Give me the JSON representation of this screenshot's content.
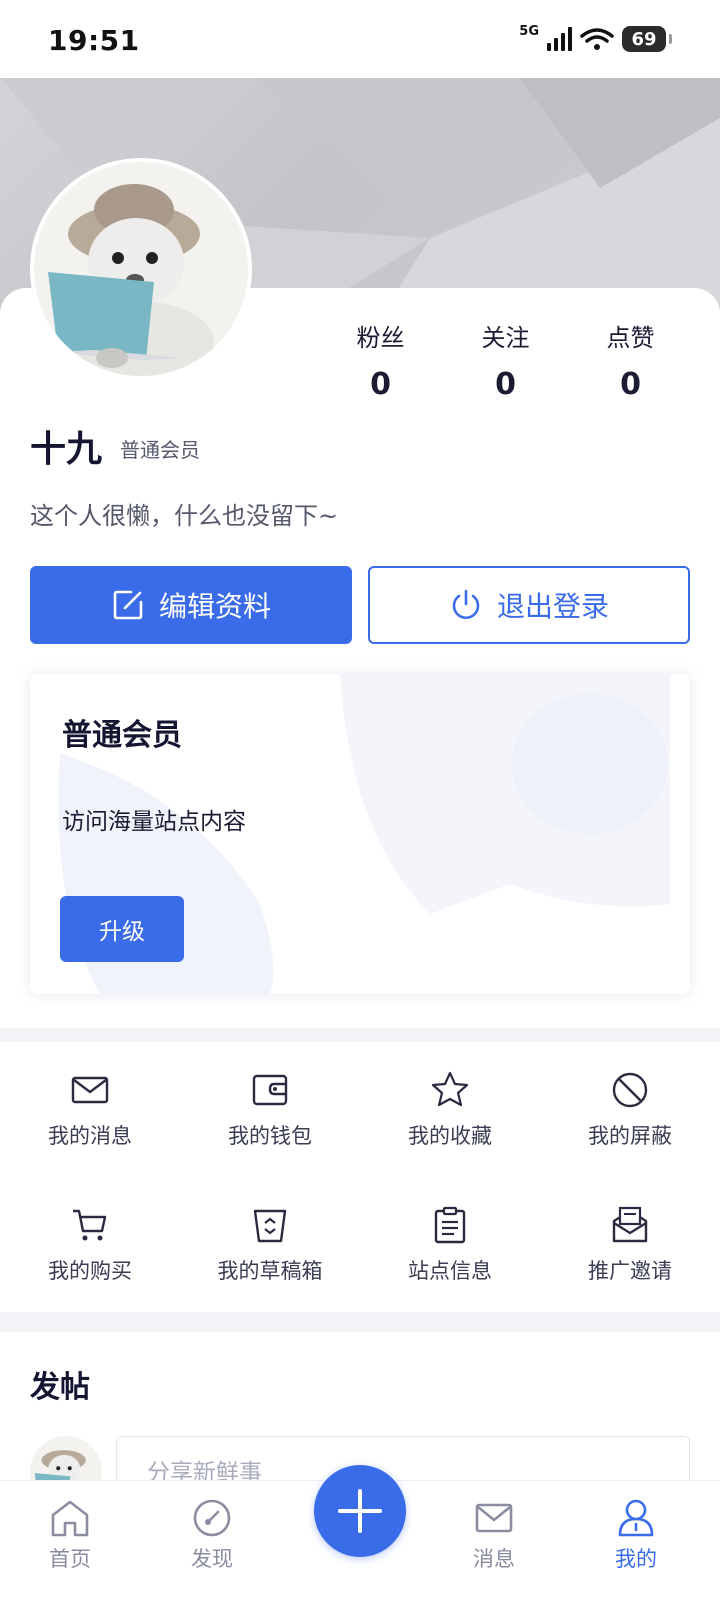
{
  "status_bar": {
    "time": "19:51",
    "network": "5G",
    "battery": "69"
  },
  "profile": {
    "username": "十九",
    "member_level": "普通会员",
    "bio": "这个人很懒，什么也没留下~",
    "stats": [
      {
        "label": "粉丝",
        "value": "0"
      },
      {
        "label": "关注",
        "value": "0"
      },
      {
        "label": "点赞",
        "value": "0"
      }
    ],
    "edit_button": "编辑资料",
    "logout_button": "退出登录"
  },
  "membership_card": {
    "title": "普通会员",
    "description": "访问海量站点内容",
    "upgrade_button": "升级"
  },
  "menu": [
    {
      "label": "我的消息",
      "icon": "envelope-icon"
    },
    {
      "label": "我的钱包",
      "icon": "wallet-icon"
    },
    {
      "label": "我的收藏",
      "icon": "star-icon"
    },
    {
      "label": "我的屏蔽",
      "icon": "block-icon"
    },
    {
      "label": "我的购买",
      "icon": "cart-icon"
    },
    {
      "label": "我的草稿箱",
      "icon": "draft-bin-icon"
    },
    {
      "label": "站点信息",
      "icon": "clipboard-icon"
    },
    {
      "label": "推广邀请",
      "icon": "invite-envelope-icon"
    }
  ],
  "post_section": {
    "title": "发帖",
    "input_placeholder": "分享新鲜事"
  },
  "bottom_nav": [
    {
      "label": "首页",
      "icon": "home-icon"
    },
    {
      "label": "发现",
      "icon": "compass-icon"
    },
    {
      "label": "消息",
      "icon": "message-icon"
    },
    {
      "label": "我的",
      "icon": "user-icon",
      "active": true
    }
  ],
  "colors": {
    "accent": "#3a6be8",
    "text": "#1b1c33",
    "muted": "#8a8da0"
  }
}
